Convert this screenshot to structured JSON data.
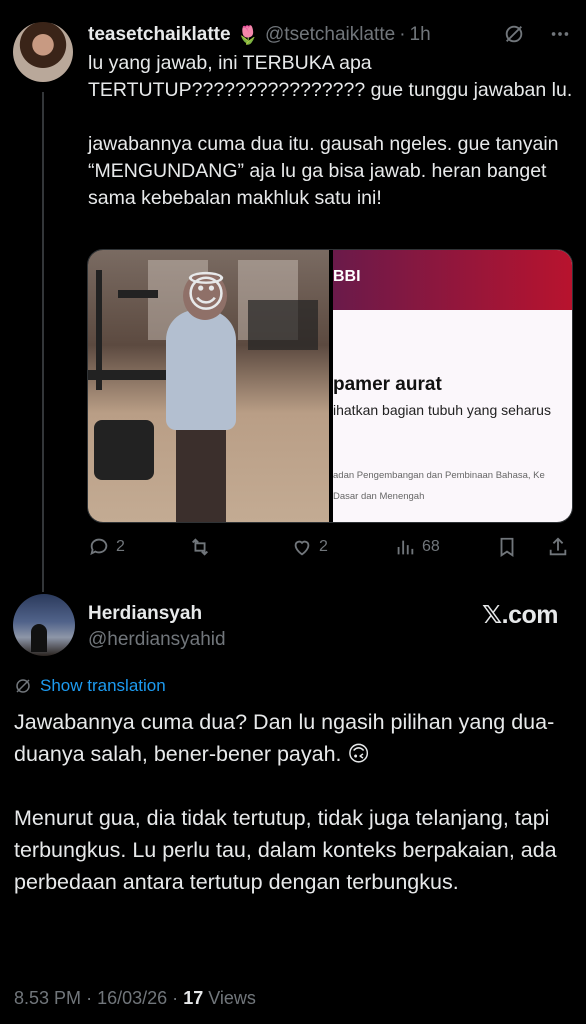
{
  "tweet1": {
    "name": "teasetchaiklatte",
    "name_emoji": "🌷",
    "handle": "@tsetchaiklatte",
    "separator": "·",
    "time": "1h",
    "text": "lu yang jawab, ini TERBUKA apa TERTUTUP???????????????? gue tunggu jawaban lu.\n\njawabannya cuma dua itu. gausah ngeles. gue tanyain “MENGUNDANG” aja lu ga bisa jawab. heran banget sama kebebalan makhluk satu ini!",
    "media_right": {
      "header": "BBI",
      "word": "pamer aurat",
      "definition": "ihatkan bagian tubuh yang seharus",
      "footer_line1": "adan Pengembangan dan Pembinaan Bahasa, Ke",
      "footer_line2": "Dasar dan Menengah"
    },
    "media_left_overlay_emoji": "😇",
    "actions": {
      "replies": "2",
      "retweets": "",
      "likes": "2",
      "views": "68"
    }
  },
  "tweet2": {
    "name": "Herdiansyah",
    "handle": "@herdiansyahid",
    "watermark": "𝕏.com",
    "translate_label": "Show translation",
    "text": "Jawabannya cuma dua? Dan lu ngasih pilihan yang dua-duanya salah, bener-bener payah. 🙃\n\nMenurut gua, dia tidak tertutup, tidak juga telanjang, tapi terbungkus. Lu perlu tau, dalam konteks berpakaian, ada perbedaan antara tertutup dengan terbungkus.",
    "time": "8.53 PM",
    "date": "16/03/26",
    "dot": "·",
    "views_count": "17",
    "views_label": "Views"
  },
  "colors": {
    "background": "#000000",
    "text": "#e7e9ea",
    "muted": "#71767b",
    "link": "#1d9bf0"
  }
}
